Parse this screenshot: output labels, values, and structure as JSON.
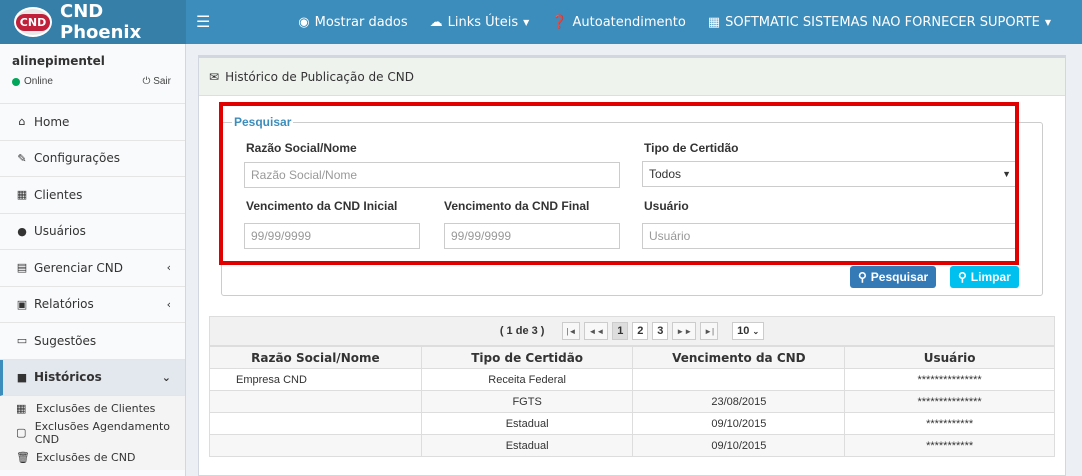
{
  "brand": {
    "badge": "CND",
    "name": "CND Phoenix"
  },
  "topnav": {
    "show_data": "Mostrar dados",
    "useful_links": "Links Úteis",
    "self_service": "Autoatendimento",
    "company": "SOFTMATIC SISTEMAS NAO FORNECER SUPORTE"
  },
  "user": {
    "name": "alinepimentel",
    "status": "Online",
    "logout": "Sair"
  },
  "sidebar": {
    "items": [
      {
        "label": "Home",
        "icon": "home-icon"
      },
      {
        "label": "Configurações",
        "icon": "wrench-icon"
      },
      {
        "label": "Clientes",
        "icon": "building-icon"
      },
      {
        "label": "Usuários",
        "icon": "user-icon"
      },
      {
        "label": "Gerenciar CND",
        "icon": "calendar-icon"
      },
      {
        "label": "Relatórios",
        "icon": "report-icon"
      },
      {
        "label": "Sugestões",
        "icon": "comments-icon"
      },
      {
        "label": "Históricos",
        "icon": "history-icon"
      }
    ],
    "sub_items": [
      {
        "label": "Exclusões de Clientes",
        "icon": "building-icon"
      },
      {
        "label": "Exclusões Agendamento CND",
        "icon": "calendar-icon"
      },
      {
        "label": "Exclusões de CND",
        "icon": "trash-icon"
      }
    ]
  },
  "panel": {
    "title": "Histórico de Publicação de CND"
  },
  "search": {
    "legend": "Pesquisar",
    "razao_label": "Razão Social/Nome",
    "razao_placeholder": "Razão Social/Nome",
    "tipo_label": "Tipo de Certidão",
    "tipo_value": "Todos",
    "venc_ini_label": "Vencimento da CND Inicial",
    "venc_ini_placeholder": "99/99/9999",
    "venc_fim_label": "Vencimento da CND Final",
    "venc_fim_placeholder": "99/99/9999",
    "usuario_label": "Usuário",
    "usuario_placeholder": "Usuário",
    "search_button": "Pesquisar",
    "clear_button": "Limpar"
  },
  "pager": {
    "status": "( 1 de 3 )",
    "pages": [
      "1",
      "2",
      "3"
    ],
    "current": "1",
    "rows_per_page": "10"
  },
  "table": {
    "headers": [
      "Razão Social/Nome",
      "Tipo de Certidão",
      "Vencimento da CND",
      "Usuário"
    ],
    "rows": [
      [
        "Empresa CND",
        "Receita Federal",
        "",
        "***************"
      ],
      [
        "",
        "FGTS",
        "23/08/2015",
        "***************"
      ],
      [
        "",
        "Estadual",
        "09/10/2015",
        "***********"
      ],
      [
        "",
        "Estadual",
        "09/10/2015",
        "***********"
      ]
    ]
  },
  "colors": {
    "header": "#3c8dbc",
    "search_button": "#337ab7",
    "clear_button": "#00c0ef",
    "highlight": "#e10000"
  }
}
